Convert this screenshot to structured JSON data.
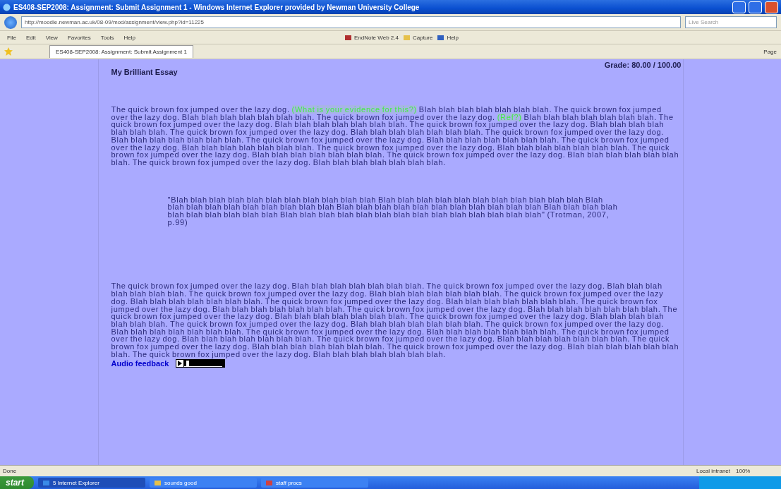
{
  "window": {
    "title": "ES408-SEP2008: Assignment: Submit Assignment 1 - Windows Internet Explorer provided by Newman University College"
  },
  "address_bar": {
    "url": "http://moodle.newman.ac.uk/08-09/mod/assignment/view.php?id=11225",
    "search_placeholder": "Live Search"
  },
  "menu": [
    "File",
    "Edit",
    "View",
    "Favorites",
    "Tools",
    "Help"
  ],
  "links": [
    {
      "label": "EndNote Web 2.4",
      "kind": "endnote"
    },
    {
      "label": "Capture",
      "kind": "folder"
    },
    {
      "label": "Help",
      "kind": "help"
    }
  ],
  "tabs": [
    {
      "label": "ES408-SEP2008: Assignment: Submit Assignment 1",
      "selected": true
    }
  ],
  "command_bar": {
    "page": "Page"
  },
  "content": {
    "grade": "Grade: 80.00 / 100.00",
    "title": "My Brilliant Essay",
    "paragraphs": [
      {
        "kind": "body",
        "segments": [
          {
            "kind": "plain",
            "text": "The quick brown fox jumped over the lazy dog. "
          },
          {
            "kind": "comment",
            "text": "(What is your evidence for this?)"
          },
          {
            "kind": "plain",
            "text": " Blah blah blah blah blah blah blah. The quick brown fox jumped over the lazy dog. Blah blah blah blah blah blah blah. The quick brown fox jumped over the lazy dog. "
          },
          {
            "kind": "comment",
            "text": "(Ref?)"
          },
          {
            "kind": "plain",
            "text": " Blah blah blah blah blah blah blah. The quick brown fox jumped over the lazy dog. Blah blah blah blah blah blah blah. The quick brown fox jumped over the lazy dog. Blah blah blah blah blah blah blah. The quick brown fox jumped over the lazy dog. Blah blah blah blah blah blah blah. The quick brown fox jumped over the lazy dog. Blah blah blah blah blah blah blah. The quick brown fox jumped over the lazy dog. Blah blah blah blah blah blah blah. The quick brown fox jumped over the lazy dog. Blah blah blah blah blah blah blah. The quick brown fox jumped over the lazy dog. Blah blah blah blah blah blah blah. The quick brown fox jumped over the lazy dog. Blah blah blah blah blah blah blah. The quick brown fox jumped over the lazy dog. Blah blah blah blah blah blah blah. The quick brown fox jumped over the lazy dog. Blah blah blah blah blah blah blah."
          }
        ]
      },
      {
        "kind": "quote",
        "segments": [
          {
            "kind": "plain",
            "text": "\"Blah blah blah blah blah blah blah blah blah blah blah Blah blah blah blah blah blah blah blah blah blah blah Blah blah blah blah blah blah blah blah blah blah Blah blah blah blah blah blah blah blah blah blah blah Blah blah blah blah blah blah blah blah blah blah Blah blah blah blah blah blah blah blah blah blah blah blah blah blah\" (Trotman, 2007, p.99)"
          }
        ]
      },
      {
        "kind": "body",
        "segments": [
          {
            "kind": "plain",
            "text": "The quick brown fox jumped over the lazy dog. Blah blah blah blah blah blah blah. The quick brown fox jumped over the lazy dog. Blah blah blah blah blah blah blah. The quick brown fox jumped over the lazy dog. Blah blah blah blah blah blah blah. The quick brown fox jumped over the lazy dog. Blah blah blah blah blah blah blah. The quick brown fox jumped over the lazy dog. Blah blah blah blah blah blah blah. The quick brown fox jumped over the lazy dog. Blah blah blah blah blah blah blah. The quick brown fox jumped over the lazy dog. Blah blah blah blah blah blah blah. The quick brown fox jumped over the lazy dog. Blah blah blah blah blah blah blah. The quick brown fox jumped over the lazy dog. Blah blah blah blah blah blah blah. The quick brown fox jumped over the lazy dog. Blah blah blah blah blah blah blah. The quick brown fox jumped over the lazy dog. Blah blah blah blah blah blah blah. The quick brown fox jumped over the lazy dog. Blah blah blah blah blah blah blah. The quick brown fox jumped over the lazy dog. Blah blah blah blah blah blah blah. The quick brown fox jumped over the lazy dog. Blah blah blah blah blah blah blah. The quick brown fox jumped over the lazy dog. Blah blah blah blah blah blah blah. The quick brown fox jumped over the lazy dog. Blah blah blah blah blah blah blah. The quick brown fox jumped over the lazy dog. Blah blah blah blah blah blah blah."
          }
        ]
      }
    ],
    "audio": {
      "label": "Audio feedback",
      "level": 0.05
    }
  },
  "status_bar": {
    "status": "Done",
    "zone": "Local intranet",
    "zoom": "100%"
  },
  "taskbar": {
    "start": "start",
    "items": [
      {
        "label": "5 Internet Explorer",
        "kind": "ie",
        "selected": true
      },
      {
        "label": "sounds good",
        "kind": "folder",
        "selected": false
      },
      {
        "label": "staff procs",
        "kind": "doc",
        "selected": false
      }
    ]
  }
}
